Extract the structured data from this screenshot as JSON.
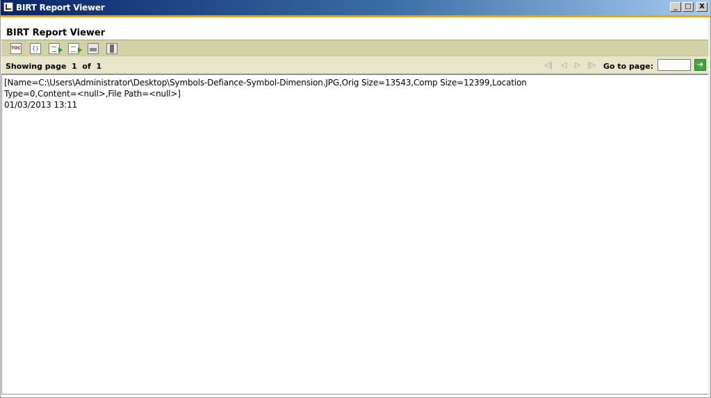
{
  "window": {
    "title": "BIRT Report Viewer",
    "controls": {
      "minimize": "_",
      "maximize": "□",
      "close": "X"
    }
  },
  "header": {
    "title": "BIRT Report Viewer"
  },
  "toolbar": {
    "items": [
      {
        "icon": "toc-icon",
        "glyph": "TOC"
      },
      {
        "icon": "parameters-icon",
        "glyph": "{}"
      },
      {
        "icon": "export-data-icon",
        "glyph": ""
      },
      {
        "icon": "export-report-icon",
        "glyph": ""
      },
      {
        "icon": "print-icon",
        "glyph": ""
      },
      {
        "icon": "print-server-icon",
        "glyph": ""
      }
    ]
  },
  "navigation": {
    "showing_label": "Showing page",
    "current_page": "1",
    "of_label": "of",
    "total_pages": "1",
    "first_glyph": "◁|",
    "prev_glyph": "◁",
    "next_glyph": "▷",
    "last_glyph": "|▷",
    "goto_label": "Go to page:",
    "goto_value": "",
    "goto_button_glyph": "➔"
  },
  "report": {
    "lines": [
      "[Name=C:\\Users\\Administrator\\Desktop\\Symbols-Defiance-Symbol-Dimension.JPG,Orig Size=13543,Comp Size=12399,Location",
      "Type=0,Content=<null>,File Path=<null>]",
      "01/03/2013 13:11"
    ]
  },
  "colors": {
    "titlebar": "#0a246a",
    "accent": "#e8a90d",
    "toolbar": "#d3d2a6",
    "navbar": "#e8e6ca",
    "goto_button": "#3ea43e"
  }
}
